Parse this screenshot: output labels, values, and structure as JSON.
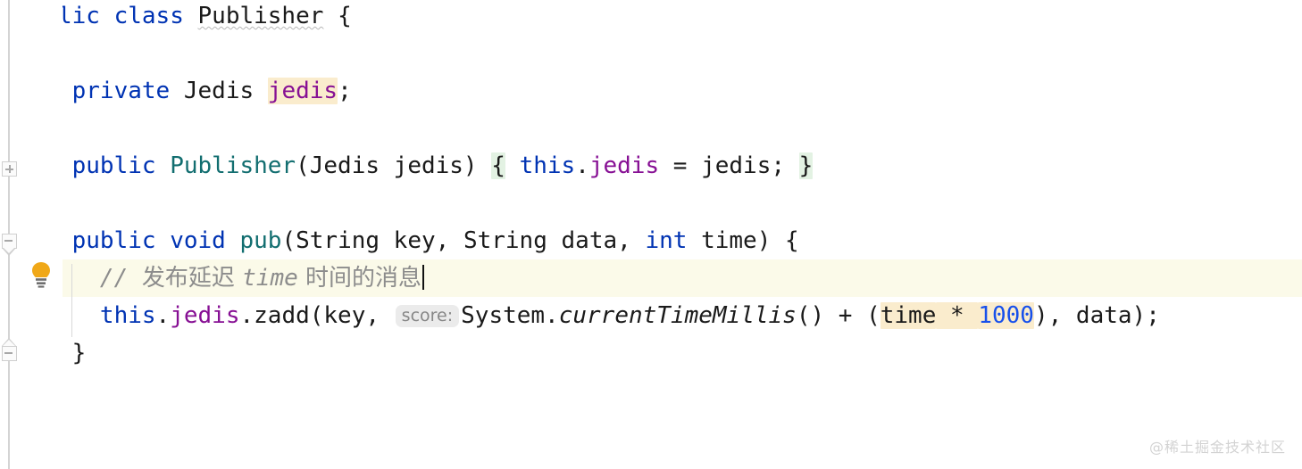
{
  "editor": {
    "language": "java",
    "theme": "IntelliJ Light",
    "colors": {
      "background": "#ffffff",
      "keyword": "#0033b3",
      "class_name": "#126e70",
      "method_name": "#126e70",
      "field": "#871094",
      "number": "#1750eb",
      "comment": "#8c8c8c",
      "plain_text": "#1a1a1a",
      "identifier_highlight": "#faeccd",
      "brace_highlight": "#e3f2e3",
      "current_line": "#fbfae9",
      "inlay_hint_text": "#878787",
      "inlay_hint_background": "#ebebeb",
      "gutter_marker": "#cfcfcf",
      "bulb": "#f0a818",
      "watermark": "#d3d3d3"
    }
  },
  "code": {
    "line1": {
      "kw_public": "public",
      "kw_class": "class",
      "name": "Publisher",
      "brace": "{"
    },
    "line3": {
      "kw_private": "private",
      "type": "Jedis",
      "field": "jedis",
      "semicolon": ";"
    },
    "line5": {
      "kw_public": "public",
      "ctor": "Publisher",
      "params": "(Jedis jedis)",
      "open_brace": "{",
      "kw_this": "this",
      "dot": ".",
      "field": "jedis",
      "assign": " = jedis; ",
      "close_brace": "}"
    },
    "line7": {
      "kw_public": "public",
      "kw_void": "void",
      "method": "pub",
      "params_a": "(String key, String data, ",
      "kw_int": "int",
      "params_b": " time) {"
    },
    "line8": {
      "comment_slashes": "// ",
      "comment_text_a": "发布延迟 ",
      "comment_text_italic": "time",
      "comment_text_b": " 时间的消息"
    },
    "line9": {
      "kw_this": "this",
      "dot1": ".",
      "field": "jedis",
      "call": ".zadd(key, ",
      "hint": "score:",
      "system": "System.",
      "static_method": "currentTimeMillis",
      "after_call": "() + (",
      "hl_time": "time",
      "hl_star": " * ",
      "hl_number": "1000",
      "tail": "), data);"
    },
    "line10": {
      "close_brace": "}"
    },
    "line12": {
      "close_brace": "}"
    }
  },
  "gutter": {
    "fold_expand_label": "+",
    "fold_collapse_label": "-",
    "intention_bulb": "lightbulb-icon"
  },
  "watermark": {
    "text": "@稀土掘金技术社区"
  }
}
